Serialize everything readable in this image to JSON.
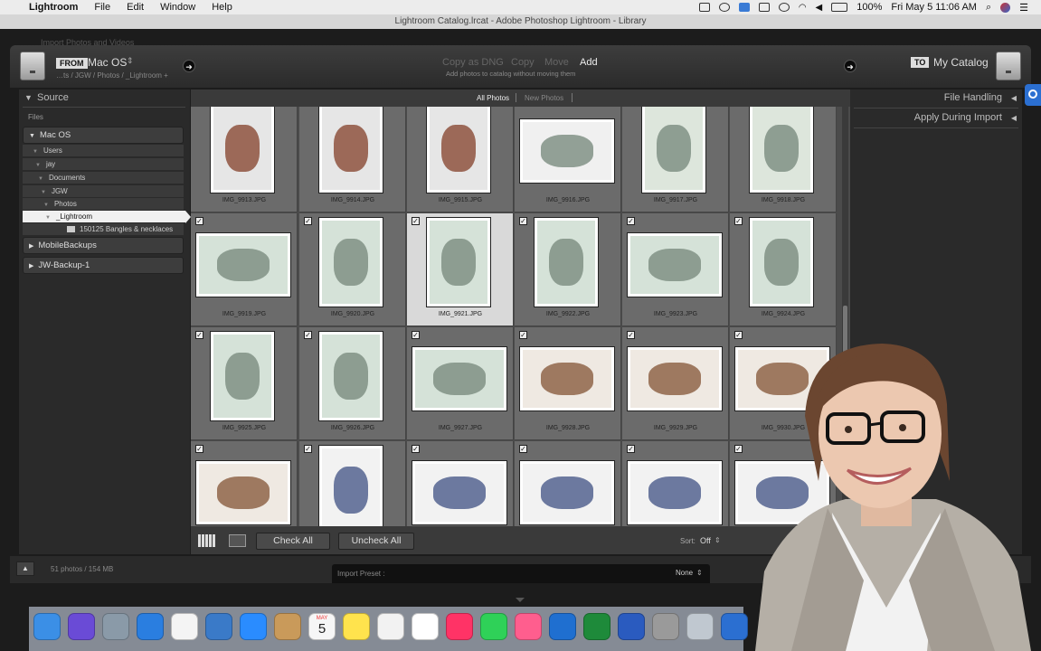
{
  "menubar": {
    "app": "Lightroom",
    "items": [
      "File",
      "Edit",
      "Window",
      "Help"
    ],
    "datetime": "Fri May 5  11:06 AM",
    "battery": "100%"
  },
  "window": {
    "title": "Lightroom Catalog.lrcat - Adobe Photoshop Lightroom - Library",
    "ghost_label": "Import Photos and Videos"
  },
  "header": {
    "from_tag": "FROM",
    "from_source": "Mac OS",
    "from_path": "…ts / JGW / Photos / _Lightroom +",
    "modes": [
      "Copy as DNG",
      "Copy",
      "Move",
      "Add"
    ],
    "active_mode": "Add",
    "mode_desc": "Add photos to catalog without moving them",
    "to_tag": "TO",
    "to_target": "My Catalog"
  },
  "source_panel": {
    "title": "Source",
    "files_label": "Files",
    "volumes": [
      "Mac OS",
      "MobileBackups",
      "JW-Backup-1"
    ],
    "tree": [
      "Users",
      "jay",
      "Documents",
      "JGW",
      "Photos",
      "_Lightroom",
      "150125 Bangles & necklaces &…"
    ]
  },
  "right_panel": {
    "file_handling": "File Handling",
    "apply_during_import": "Apply During Import"
  },
  "grid": {
    "tab_all": "All Photos",
    "tab_new": "New Photos",
    "files": [
      "IMG_9913.JPG",
      "IMG_9914.JPG",
      "IMG_9915.JPG",
      "IMG_9916.JPG",
      "IMG_9917.JPG",
      "IMG_9918.JPG",
      "IMG_9919.JPG",
      "IMG_9920.JPG",
      "IMG_9921.JPG",
      "IMG_9922.JPG",
      "IMG_9923.JPG",
      "IMG_9924.JPG",
      "IMG_9925.JPG",
      "IMG_9926.JPG",
      "IMG_9927.JPG",
      "IMG_9928.JPG",
      "IMG_9929.JPG",
      "IMG_9930.JPG"
    ]
  },
  "toolbar": {
    "check_all": "Check All",
    "uncheck_all": "Uncheck All",
    "sort_label": "Sort:",
    "sort_value": "Off"
  },
  "footer": {
    "summary": "51 photos / 154 MB",
    "preset_label": "Import Preset :",
    "preset_value": "None"
  },
  "dock": {
    "calendar_month": "MAY",
    "calendar_day": "5"
  },
  "colors": {
    "accent": "#e7e7e7",
    "panel_bg": "#2a2a2a",
    "grid_bg": "#4b4b4b",
    "cell_bg": "#6b6b6b"
  }
}
